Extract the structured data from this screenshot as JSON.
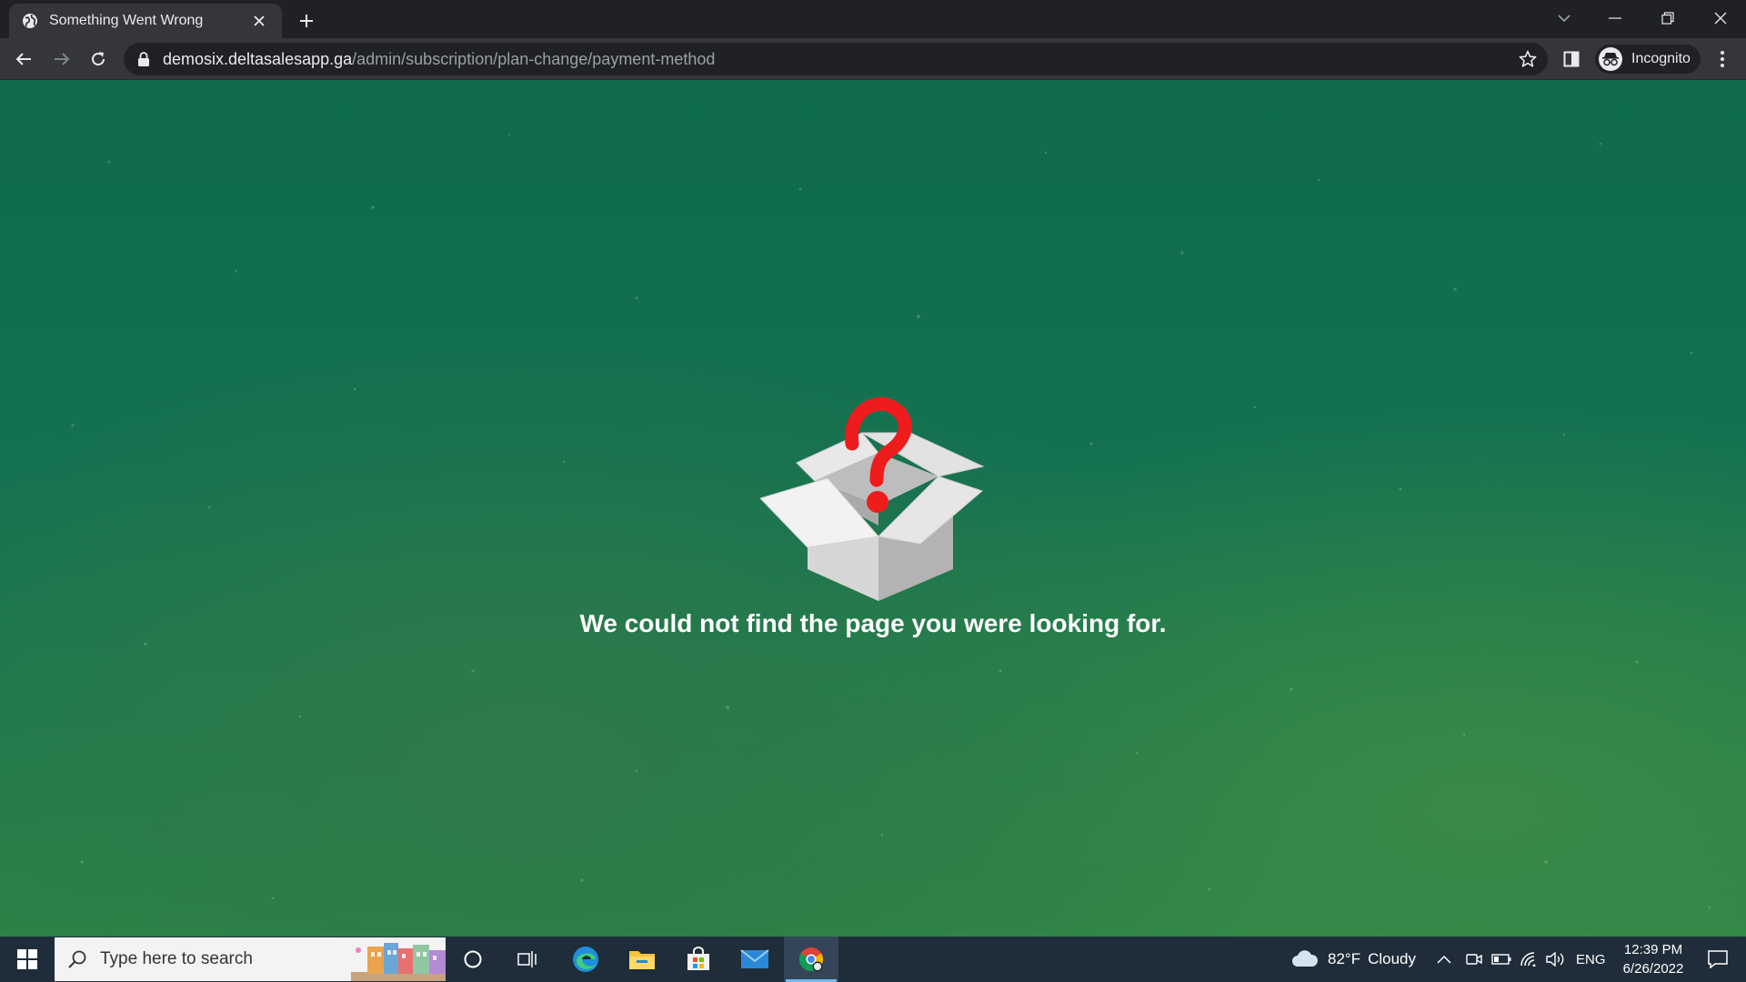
{
  "tab": {
    "title": "Something Went Wrong"
  },
  "address_bar": {
    "url_host": "demosix.deltasalesapp.ga",
    "url_path": "/admin/subscription/plan-change/payment-method"
  },
  "profile": {
    "label": "Incognito"
  },
  "page": {
    "message": "We could not find the page you were looking for."
  },
  "taskbar": {
    "search_placeholder": "Type here to search",
    "weather": {
      "temperature": "82°F",
      "condition": "Cloudy"
    },
    "language": "ENG",
    "time": "12:39 PM",
    "date": "6/26/2022"
  },
  "colors": {
    "page_background": "#137151",
    "question_mark": "#ee1c1c",
    "taskbar": "#1f2d3a",
    "chrome_dark": "#202124",
    "chrome_toolbar": "#35363a"
  }
}
